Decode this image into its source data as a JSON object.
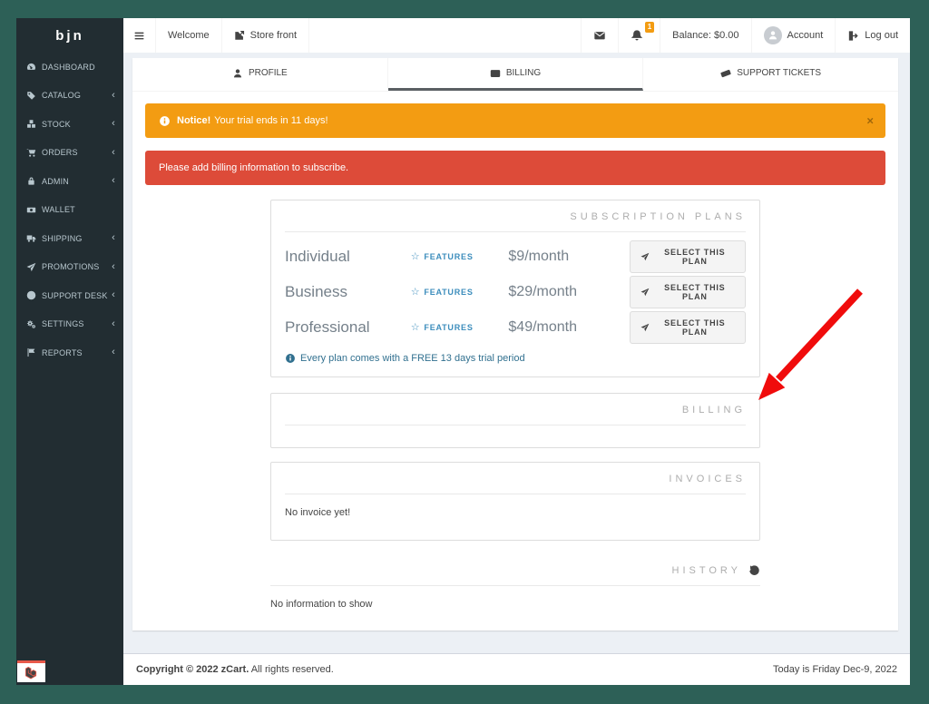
{
  "app": {
    "logo": "bjn"
  },
  "icons": {
    "star": "☆",
    "close": "×",
    "chevron": "‹"
  },
  "sidebar": {
    "items": [
      {
        "icon": "dashboard",
        "label": "DASHBOARD",
        "expandable": false
      },
      {
        "icon": "tag",
        "label": "CATALOG",
        "expandable": true
      },
      {
        "icon": "cubes",
        "label": "STOCK",
        "expandable": true
      },
      {
        "icon": "cart",
        "label": "ORDERS",
        "expandable": true
      },
      {
        "icon": "lock",
        "label": "ADMIN",
        "expandable": true
      },
      {
        "icon": "money",
        "label": "WALLET",
        "expandable": false
      },
      {
        "icon": "truck",
        "label": "SHIPPING",
        "expandable": true
      },
      {
        "icon": "paper-plane",
        "label": "PROMOTIONS",
        "expandable": true
      },
      {
        "icon": "life-ring",
        "label": "SUPPORT DESK",
        "expandable": true
      },
      {
        "icon": "gears",
        "label": "SETTINGS",
        "expandable": true
      },
      {
        "icon": "flag",
        "label": "REPORTS",
        "expandable": true
      }
    ]
  },
  "topbar": {
    "welcome": "Welcome",
    "storefront": "Store front",
    "notification_count": "1",
    "balance": "Balance: $0.00",
    "account": "Account",
    "logout": "Log out"
  },
  "tabs": [
    {
      "icon": "user",
      "label": "PROFILE",
      "active": false
    },
    {
      "icon": "credit-card",
      "label": "BILLING",
      "active": true
    },
    {
      "icon": "ticket",
      "label": "SUPPORT TICKETS",
      "active": false
    }
  ],
  "alerts": {
    "trial": {
      "prefix": "Notice!",
      "message": "Your trial ends in 11 days!"
    },
    "billing": {
      "message": "Please add billing information to subscribe."
    }
  },
  "plans": {
    "heading": "SUBSCRIPTION PLANS",
    "rows": [
      {
        "name": "Individual",
        "features_label": "FEATURES",
        "price": "$9/month",
        "select_label": "SELECT THIS PLAN"
      },
      {
        "name": "Business",
        "features_label": "FEATURES",
        "price": "$29/month",
        "select_label": "SELECT THIS PLAN"
      },
      {
        "name": "Professional",
        "features_label": "FEATURES",
        "price": "$49/month",
        "select_label": "SELECT THIS PLAN"
      }
    ],
    "note": "Every plan comes with a FREE 13 days trial period"
  },
  "billing_section": {
    "heading": "BILLING"
  },
  "invoices_section": {
    "heading": "INVOICES",
    "empty_message": "No invoice yet!"
  },
  "history_section": {
    "heading": "HISTORY",
    "empty_message": "No information to show"
  },
  "footer": {
    "copyright_strong": "Copyright © 2022 zCart.",
    "copyright_rest": "All rights reserved.",
    "date": "Today is Friday Dec-9, 2022"
  },
  "colors": {
    "frame": "#2d6057",
    "sidebar_bg": "#222d32",
    "warning": "#f39c12",
    "danger": "#dd4b39",
    "link_blue": "#3c8dbc",
    "info_blue": "#31708f",
    "tab_underline": "#5a5f63",
    "arrow_red": "#f00c0c"
  }
}
